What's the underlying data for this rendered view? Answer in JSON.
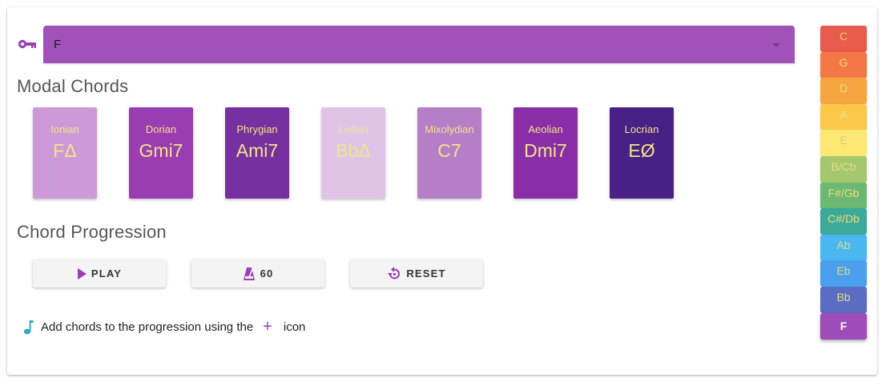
{
  "key_selector": {
    "value": "F",
    "icon": "key-icon",
    "color": "#a052b8"
  },
  "modal_section": {
    "title": "Modal Chords"
  },
  "modes": [
    {
      "name": "Ionian",
      "chord": "FΔ",
      "color": "#cc9ad9"
    },
    {
      "name": "Dorian",
      "chord": "Gmi7",
      "color": "#9a3cb2"
    },
    {
      "name": "Phrygian",
      "chord": "Ami7",
      "color": "#77309f"
    },
    {
      "name": "Lydian",
      "chord": "BbΔ",
      "color": "#e1c3e8"
    },
    {
      "name": "Mixolydian",
      "chord": "C7",
      "color": "#b57ec7"
    },
    {
      "name": "Aeolian",
      "chord": "Dmi7",
      "color": "#892ea6"
    },
    {
      "name": "Locrian",
      "chord": "EØ",
      "color": "#4a1f86"
    }
  ],
  "progression_section": {
    "title": "Chord Progression"
  },
  "buttons": {
    "play": {
      "label": "PLAY",
      "icon": "play-icon"
    },
    "tempo": {
      "label": "60",
      "icon": "metronome-icon"
    },
    "reset": {
      "label": "RESET",
      "icon": "reset-icon"
    }
  },
  "hint": {
    "icon": "music-note-icon",
    "text_before": "Add chords to the progression using the",
    "plus_icon": "plus-icon",
    "text_after": "icon"
  },
  "key_palette": [
    {
      "label": "C",
      "color": "#e85c4e",
      "text_color": "#f1c96a"
    },
    {
      "label": "G",
      "color": "#f47846",
      "text_color": "#f5d66f"
    },
    {
      "label": "D",
      "color": "#f6a640",
      "text_color": "#f5d86c"
    },
    {
      "label": "A",
      "color": "#fbc84a",
      "text_color": "#f2e17f"
    },
    {
      "label": "E",
      "color": "#fde874",
      "text_color": "#d8ce7c"
    },
    {
      "label": "B/Cb",
      "color": "#a5c86e",
      "text_color": "#e6e080"
    },
    {
      "label": "F#/Gb",
      "color": "#6cb771",
      "text_color": "#e9e07d"
    },
    {
      "label": "C#/Db",
      "color": "#3da99b",
      "text_color": "#e9e07d"
    },
    {
      "label": "Ab",
      "color": "#4bb7f0",
      "text_color": "#e3dc7e"
    },
    {
      "label": "Eb",
      "color": "#4aa0ee",
      "text_color": "#e3dc7e"
    },
    {
      "label": "Bb",
      "color": "#5a6dc2",
      "text_color": "#e3dc7e"
    },
    {
      "label": "F",
      "color": "#9e4cb8",
      "text_color": "#ffffff",
      "selected": true
    }
  ]
}
